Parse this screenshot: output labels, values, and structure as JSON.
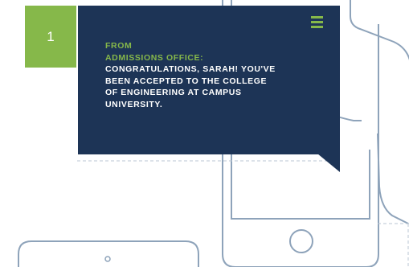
{
  "step": {
    "number": "1"
  },
  "message": {
    "from_label": "FROM",
    "sender": "ADMISSIONS OFFICE:",
    "body": "CONGRATULATIONS, SARAH! YOU'VE BEEN ACCEPTED TO THE COLLEGE OF ENGINEERING AT CAMPUS UNIVERSITY."
  },
  "icons": {
    "menu": "hamburger-menu-icon",
    "phone": "phone-outline-icon",
    "hand": "hand-outline-icon",
    "tablet": "tablet-outline-icon"
  },
  "colors": {
    "card_background": "#1d3456",
    "accent_green": "#86b84a",
    "outline_blue": "#8ea3ba",
    "message_text": "#ffffff"
  }
}
